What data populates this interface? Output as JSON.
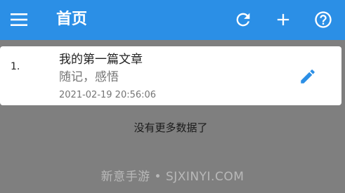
{
  "appbar": {
    "title": "首页",
    "menu_icon": "menu-icon",
    "actions": [
      {
        "name": "refresh",
        "icon": "refresh-icon"
      },
      {
        "name": "add",
        "icon": "plus-icon"
      },
      {
        "name": "help",
        "icon": "help-circle-icon"
      }
    ],
    "color": "#2b8fe6"
  },
  "articles": [
    {
      "index": "1.",
      "title": "我的第一篇文章",
      "tags": "随记，感悟",
      "date": "2021-02-19 20:56:06",
      "edit_icon": "pencil-icon"
    }
  ],
  "list_footer": "没有更多数据了",
  "watermark": "新意手游 • SJXINYI.COM",
  "colors": {
    "overlay_background": "#7f7f7f",
    "accent": "#2b8fe6",
    "card_background": "#ffffff"
  }
}
